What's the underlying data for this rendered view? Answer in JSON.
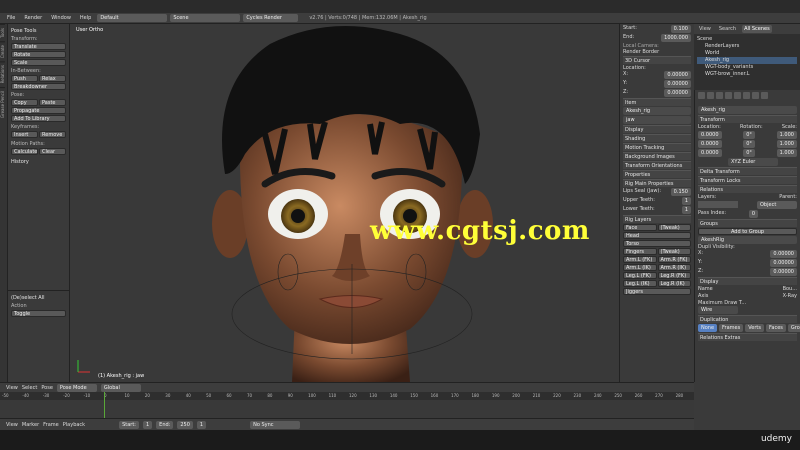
{
  "topbar": {
    "menus": [
      "File",
      "Render",
      "Window",
      "Help"
    ],
    "layout": "Default",
    "scene": "Scene",
    "engine": "Cycles Render",
    "info": "v2.76 | Verts:0/748 | Mem:132.06M | Akesh_rig"
  },
  "toolshelf": {
    "tabs": [
      "Tools",
      "Create",
      "Relations",
      "Grease Pencil"
    ],
    "title": "Pose Tools",
    "transform_label": "Transform:",
    "translate": "Translate",
    "rotate": "Rotate",
    "scale": "Scale",
    "inbetween_label": "In-Between:",
    "push": "Push",
    "relax": "Relax",
    "breakdowner": "Breakdowner",
    "pose_label": "Pose:",
    "copy": "Copy",
    "paste": "Paste",
    "propagate": "Propagate",
    "add_library": "Add To Library",
    "keyframes_label": "Keyframes:",
    "insert": "Insert",
    "remove": "Remove",
    "motion_label": "Motion Paths:",
    "calculate": "Calculate",
    "clear": "Clear",
    "history": "History",
    "deselect_all": "(De)select All",
    "action_label": "Action",
    "action_value": "Toggle"
  },
  "viewport": {
    "view_label": "User Ortho",
    "object_label": "(1) Akesh_rig : jaw",
    "watermark": "www.cgtsj.com"
  },
  "npanel": {
    "start_label": "Start:",
    "start_value": "0.100",
    "end_label": "End:",
    "end_value": "1000.000",
    "local_camera": "Local Camera:",
    "render_border": "Render Border",
    "cursor_title": "3D Cursor",
    "location_label": "Location:",
    "cx": "X:",
    "cx_value": "0.00000",
    "cy": "Y:",
    "cy_value": "0.00000",
    "cz": "Z:",
    "cz_value": "0.00000",
    "item_title": "Item",
    "item_name": "Akesh_rig",
    "bone_name": "jaw",
    "display": "Display",
    "shading": "Shading",
    "motion_tracking": "Motion Tracking",
    "background_images": "Background Images",
    "transform_orientations": "Transform Orientations",
    "properties": "Properties",
    "rig_main": "Rig Main Properties",
    "lips_seal_label": "Lips Seal (Jaw):",
    "lips_seal_value": "0.150",
    "upper_teeth_label": "Upper Teeth:",
    "upper_teeth_value": "1",
    "lower_teeth_label": "Lower Teeth:",
    "lower_teeth_value": "1",
    "rig_layers": "Rig Layers",
    "face": "Face",
    "tweak": "(Tweak)",
    "head": "Head",
    "torso": "Torso",
    "fingers": "Fingers",
    "fingers_tweak": "(Tweak)",
    "arm_l_fk": "Arm.L (FK)",
    "arm_r_fk": "Arm.R (FK)",
    "arm_l_ik": "Arm.L (IK)",
    "arm_r_ik": "Arm.R (IK)",
    "leg_l_fk": "Leg.L (FK)",
    "leg_r_fk": "Leg.R (FK)",
    "leg_l_ik": "Leg.L (IK)",
    "leg_r_ik": "Leg.R (IK)",
    "jiggers": "Jiggers"
  },
  "outliner": {
    "tabs": [
      "View",
      "Search",
      "All Scenes"
    ],
    "items": [
      "Scene",
      "RenderLayers",
      "World",
      "Akesh_rig",
      "WGT-body_variants",
      "WGT-brow_inner.L"
    ]
  },
  "props": {
    "name": "Akesh_rig",
    "transform": "Transform",
    "location": "Location:",
    "rotation": "Rotation:",
    "scale": "Scale:",
    "lx": "0.0000",
    "ly": "0.0000",
    "lz": "0.0000",
    "rx": "0°",
    "ry": "0°",
    "rz": "0°",
    "sx": "1.000",
    "sy": "1.000",
    "sz": "1.000",
    "rot_mode": "XYZ Euler",
    "delta": "Delta Transform",
    "locks": "Transform Locks",
    "relations": "Relations",
    "layers": "Layers:",
    "parent": "Parent:",
    "parent_type": "Object",
    "pass_index": "Pass Index:",
    "pass_value": "0",
    "groups": "Groups",
    "add_group": "Add to Group",
    "group_name": "AkeshRig",
    "dupli_vis": "Dupli Visibility:",
    "gx": "X:",
    "gx_value": "0.00000",
    "gy": "Y:",
    "gy_value": "0.00000",
    "gz": "Z:",
    "gz_value": "0.00000",
    "display": "Display",
    "dname": "Name",
    "daxis": "Axis",
    "dbounds": "Bou...",
    "dxray": "X-Ray",
    "max_draw": "Maximum Draw T...",
    "draw_type": "Wire",
    "duplication": "Duplication",
    "dup_tabs": [
      "None",
      "Frames",
      "Verts",
      "Faces",
      "Group"
    ],
    "relations_extras": "Relations Extras"
  },
  "viewport_header": {
    "menus": [
      "View",
      "Select",
      "Pose"
    ],
    "mode": "Pose Mode",
    "orientation": "Global"
  },
  "timeline": {
    "ticks": [
      "-50",
      "-40",
      "-30",
      "-20",
      "-10",
      "0",
      "10",
      "20",
      "30",
      "40",
      "50",
      "60",
      "70",
      "80",
      "90",
      "100",
      "110",
      "120",
      "130",
      "140",
      "150",
      "160",
      "170",
      "180",
      "190",
      "200",
      "210",
      "220",
      "230",
      "240",
      "250",
      "260",
      "270",
      "280"
    ],
    "current_frame": 0
  },
  "timeline_header": {
    "menus": [
      "View",
      "Marker",
      "Frame",
      "Playback"
    ],
    "start_label": "Start:",
    "start_value": "1",
    "end_label": "End:",
    "end_value": "250",
    "current": "1",
    "sync": "No Sync"
  },
  "brand": "udemy"
}
